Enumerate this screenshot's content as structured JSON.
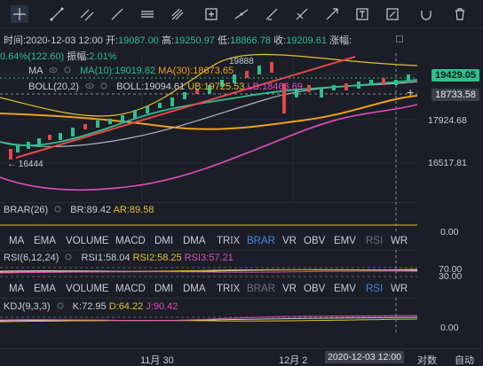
{
  "ohlc": {
    "time_label": "时间:",
    "time": "2020-12-03 12:00",
    "open_label": "开:",
    "open": "19087.00",
    "high_label": "高:",
    "high": "19250.97",
    "low_label": "低:",
    "low": "18866.78",
    "close_label": "收:",
    "close": "19209.61",
    "change_label": "涨幅:",
    "change_pct": "0.64%(122.60)",
    "amp_label": "振幅:",
    "amp": "2.01%"
  },
  "ma": {
    "name": "MA",
    "ma10": "MA(10):19019.82",
    "ma30": "MA(30):18673.65"
  },
  "boll": {
    "name": "BOLL(20,2)",
    "boll": "BOLL:19094.61",
    "ub": "UB:19725.53",
    "lb": "LB:18463.69"
  },
  "price": {
    "current": "19429.05",
    "cursor": "18733.58",
    "tick1": "17924.68",
    "tick2": "16517.81",
    "high_mark": "19888",
    "low_mark": "← 16444"
  },
  "brar": {
    "name": "BRAR(26)",
    "br": "BR:89.42",
    "ar": "AR:89.58",
    "axis": "0.00"
  },
  "rsi": {
    "name": "RSI(6,12,24)",
    "rsi1": "RSI1:58.04",
    "rsi2": "RSI2:58.25",
    "rsi3": "RSI3:57.21",
    "axis_top": "70.00",
    "axis_bottom": "30.00"
  },
  "kdj": {
    "name": "KDJ(9,3,3)",
    "k": "K:72.95",
    "d": "D:64.22",
    "j": "J:90.42",
    "axis": "0.00"
  },
  "tabs": [
    "MA",
    "EMA",
    "VOLUME",
    "MACD",
    "DMI",
    "DMA",
    "TRIX",
    "BRAR",
    "VR",
    "OBV",
    "EMV",
    "RSI",
    "WR"
  ],
  "time_axis": {
    "t1": "11月 30",
    "t2": "12月 2",
    "cursor": "2020-12-03 12:00",
    "log": "对数",
    "auto": "自动"
  },
  "colors": {
    "up": "#2fbf8f",
    "down": "#e2484b",
    "ma10": "#2fbf8f",
    "ma30": "#f0a020",
    "boll": "#b5b5c0",
    "ub": "#e2c230",
    "lb": "#e04fbf",
    "selected": "#4a84e6"
  }
}
